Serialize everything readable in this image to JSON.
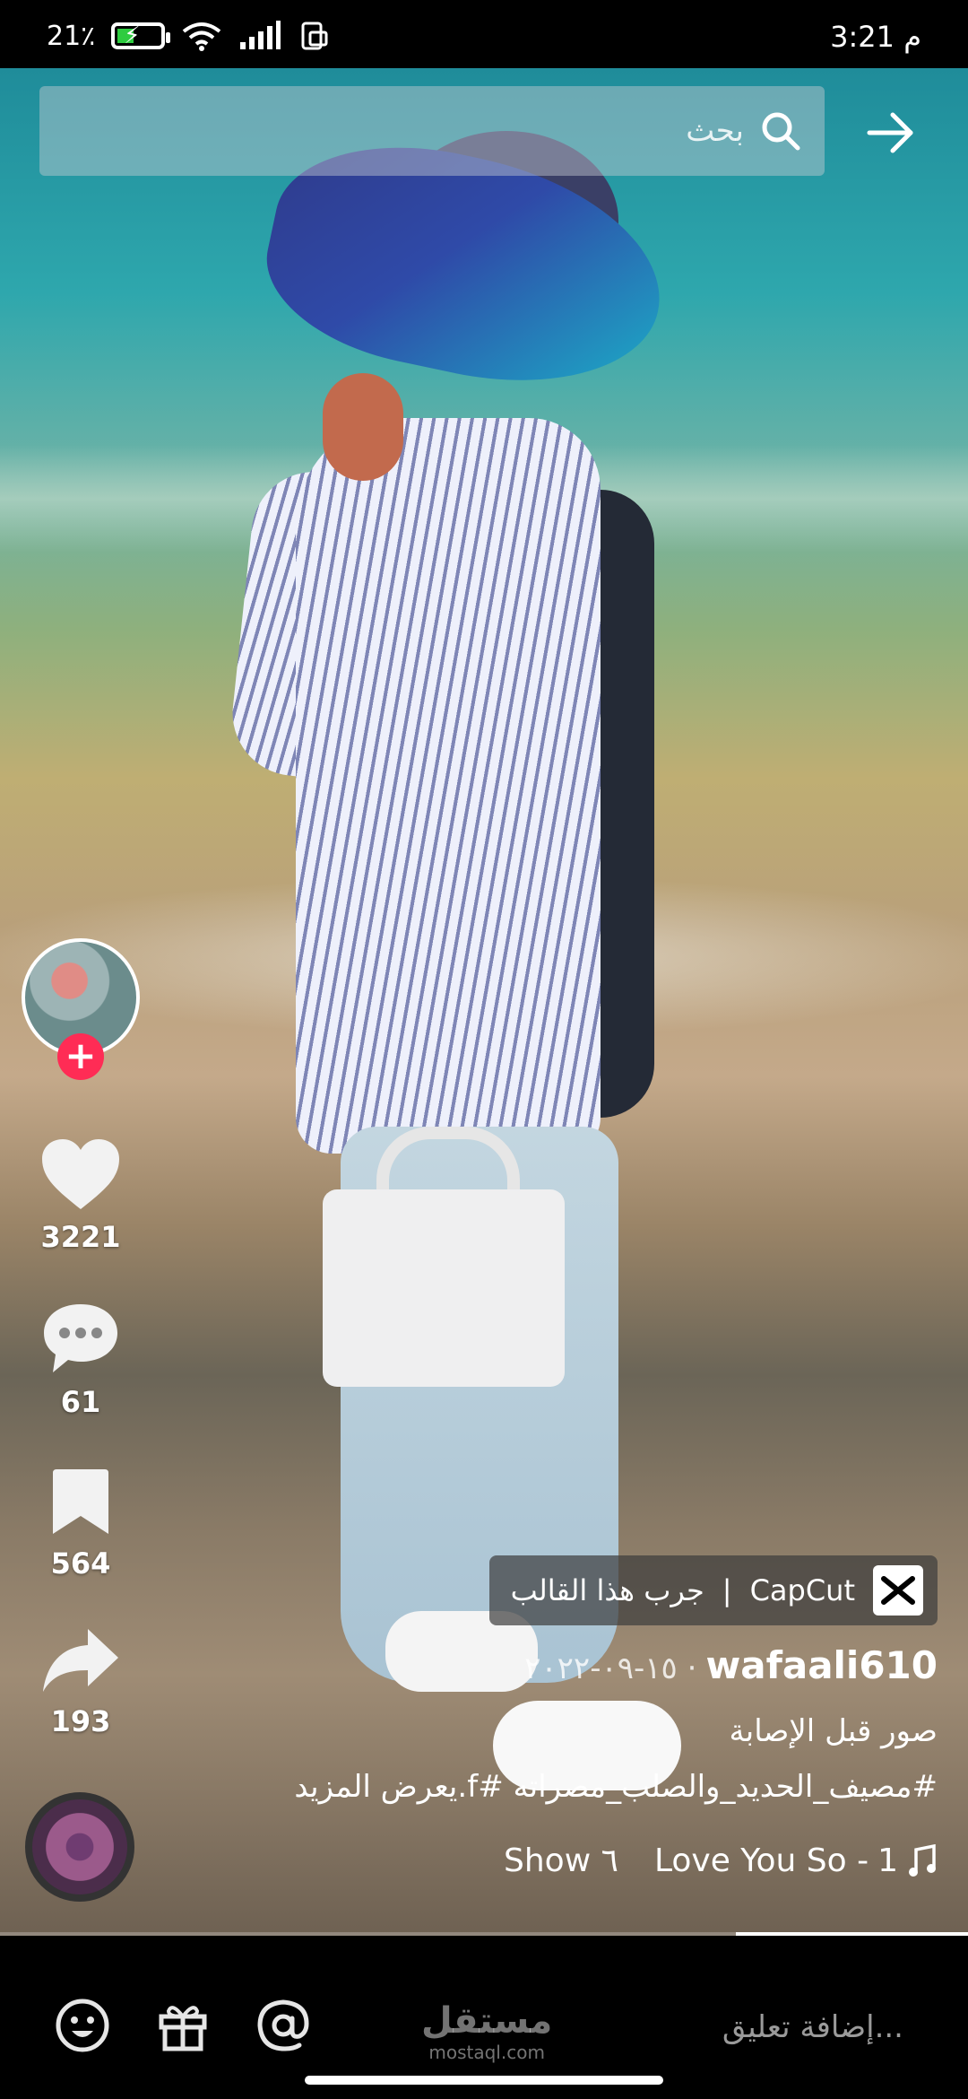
{
  "status_bar": {
    "time": "3:21 م",
    "battery_percent": "21٪"
  },
  "search": {
    "placeholder": "بحث"
  },
  "rail": {
    "likes": "3221",
    "comments": "61",
    "saves": "564",
    "shares": "193"
  },
  "capcut": {
    "brand": "CapCut",
    "label": "جرب هذا القالب"
  },
  "post": {
    "username": "wafaali610",
    "date": "١٥-٠٩-٢٠٢٢ ·",
    "caption_line1": "صور قبل الإصابة",
    "caption_line2": "#مصيف_الحديد_والصلب_مصراته #f.يعرض المزيد",
    "music_title": "Love You So - ",
    "music_partial": "Show"
  },
  "progress": {
    "fraction": 0.24
  },
  "comment_bar": {
    "placeholder": "إضافة تعليق...",
    "watermark_ar": "مستقل",
    "watermark_en": "mostaql.com"
  },
  "colors": {
    "follow_accent": "#ff2c55"
  }
}
